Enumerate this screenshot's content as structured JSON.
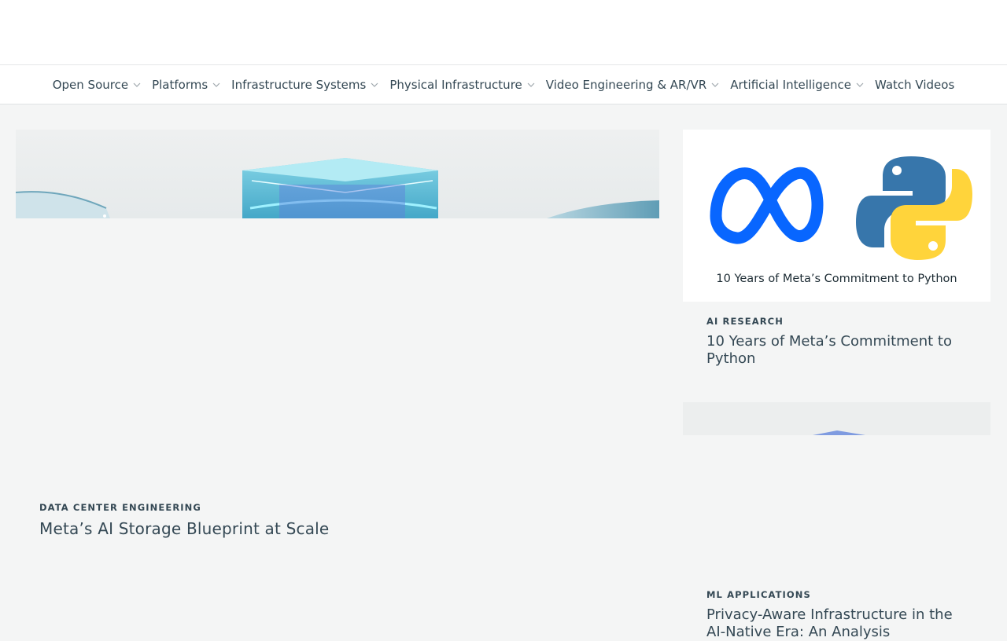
{
  "nav": {
    "items": [
      {
        "label": "Open Source",
        "dropdown": true
      },
      {
        "label": "Platforms",
        "dropdown": true
      },
      {
        "label": "Infrastructure Systems",
        "dropdown": true
      },
      {
        "label": "Physical Infrastructure",
        "dropdown": true
      },
      {
        "label": "Video Engineering & AR/VR",
        "dropdown": true
      },
      {
        "label": "Artificial Intelligence",
        "dropdown": true
      },
      {
        "label": "Watch Videos",
        "dropdown": false
      }
    ]
  },
  "hero": {
    "category": "DATA CENTER ENGINEERING",
    "title": "Meta’s AI Storage Blueprint at Scale"
  },
  "card1": {
    "image_caption": "10 Years of Meta’s Commitment to Python",
    "category": "AI RESEARCH",
    "title": "10 Years of Meta’s Commitment to Python"
  },
  "card2": {
    "category": "ML APPLICATIONS",
    "title": "Privacy-Aware Infrastructure in the AI-Native Era: An Analysis"
  },
  "colors": {
    "meta_blue": "#0866ff",
    "python_blue": "#3776ab",
    "python_yellow": "#ffd43b",
    "text": "#344854"
  }
}
